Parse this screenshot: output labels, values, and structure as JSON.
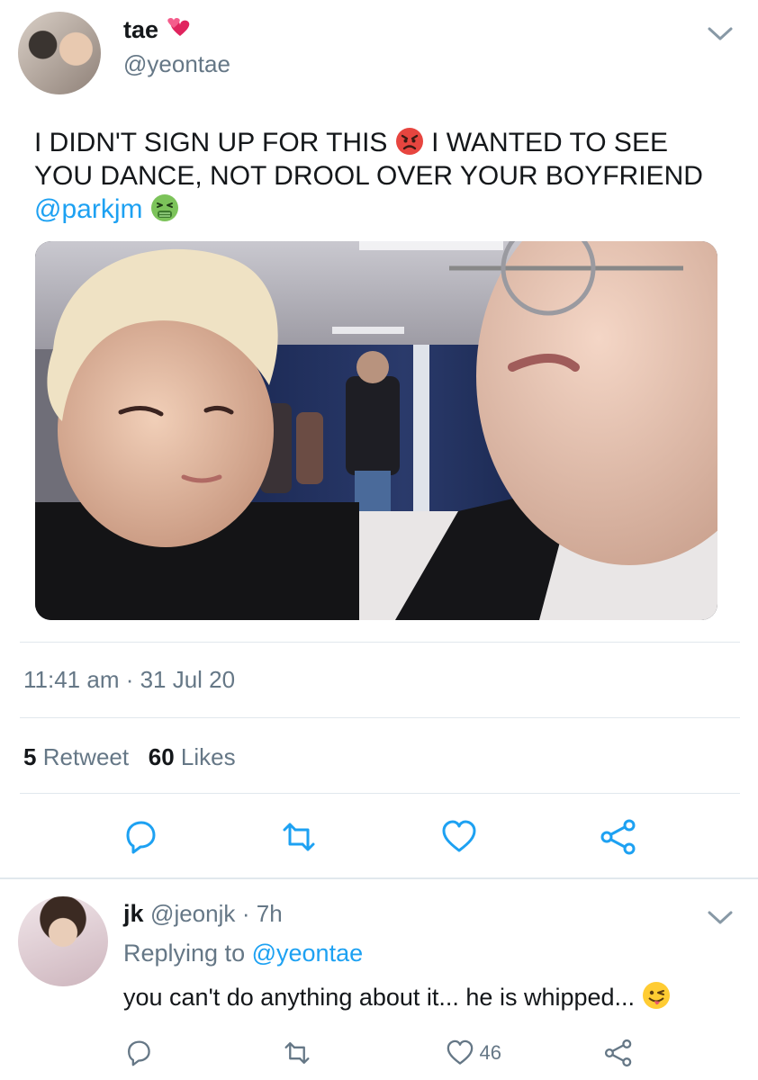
{
  "main_tweet": {
    "author_name": "tae",
    "author_handle": "@yeontae",
    "text_line_1": "I DIDN'T SIGN UP FOR THIS",
    "text_line_1b": "I WANTED TO SEE",
    "text_line_2": "YOU DANCE, NOT DROOL OVER YOUR BOYFRIEND",
    "mention": "@parkjm",
    "timestamp": "11:41 am · 31 Jul 20",
    "retweet_count": "5",
    "retweet_label": "Retweet",
    "like_count": "60",
    "like_label": "Likes",
    "icons": [
      "two-hearts-icon",
      "angry-face-icon",
      "nauseated-face-icon",
      "reply-icon",
      "retweet-icon",
      "heart-icon",
      "share-icon",
      "chevron-down-icon"
    ]
  },
  "reply": {
    "author_name": "jk",
    "author_handle": "@jeonjk",
    "time": "· 7h",
    "replying_label": "Replying to",
    "replying_to": "@yeontae",
    "text": "you can't do anything about it... he is whipped...",
    "like_count": "46",
    "icons": [
      "winking-tongue-face-icon",
      "reply-icon",
      "retweet-icon",
      "heart-icon",
      "share-icon",
      "chevron-down-icon"
    ]
  },
  "colors": {
    "accent": "#1da1f2",
    "text": "#14171a",
    "muted": "#657786",
    "divider": "#e1e8ed"
  }
}
